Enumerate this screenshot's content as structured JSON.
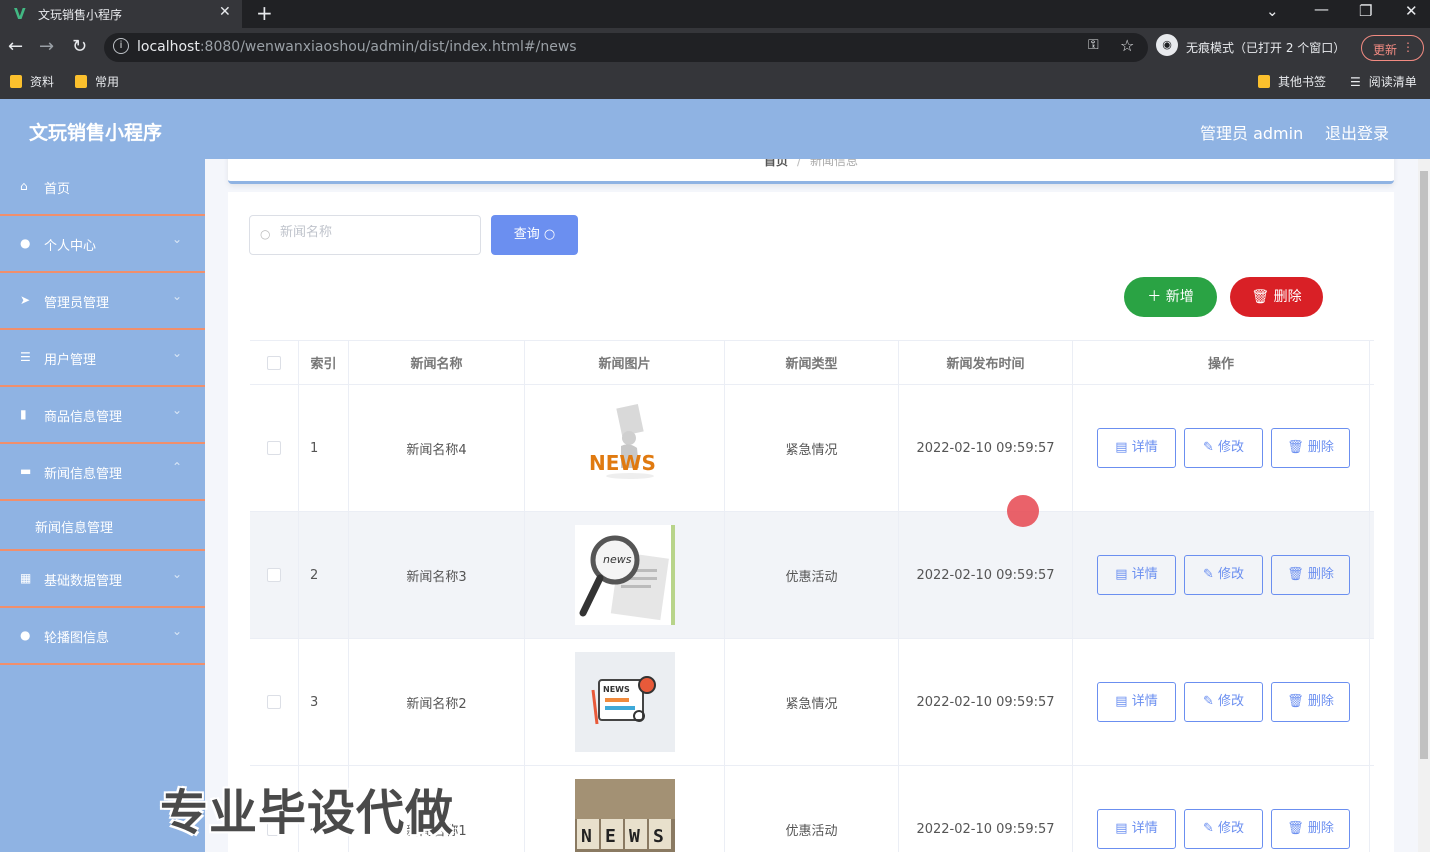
{
  "browser": {
    "tab_title": "文玩销售小程序",
    "url_host": "localhost",
    "url_path": ":8080/wenwanxiaoshou/admin/dist/index.html#/news",
    "incognito_label": "无痕模式（已打开 2 个窗口）",
    "update_label": "更新",
    "bookmarks": [
      "资料",
      "常用"
    ],
    "bookmarks_right": [
      "其他书签",
      "阅读清单"
    ]
  },
  "header": {
    "title": "文玩销售小程序",
    "admin_label": "管理员 admin",
    "logout_label": "退出登录"
  },
  "sidebar": {
    "items": [
      {
        "label": "首页",
        "icon": "home-icon"
      },
      {
        "label": "个人中心",
        "icon": "user-icon"
      },
      {
        "label": "管理员管理",
        "icon": "send-icon"
      },
      {
        "label": "用户管理",
        "icon": "list-icon"
      },
      {
        "label": "商品信息管理",
        "icon": "bar-chart-icon"
      },
      {
        "label": "新闻信息管理",
        "icon": "news-icon"
      },
      {
        "label": "基础数据管理",
        "icon": "grid-icon"
      },
      {
        "label": "轮播图信息",
        "icon": "user-icon"
      }
    ],
    "sub_item": "新闻信息管理"
  },
  "breadcrumb": {
    "home": "首页",
    "current": "新闻信息"
  },
  "search": {
    "placeholder": "新闻名称",
    "button": "查询"
  },
  "actions": {
    "add": "新增",
    "delete": "删除"
  },
  "table": {
    "columns": [
      "索引",
      "新闻名称",
      "新闻图片",
      "新闻类型",
      "新闻发布时间",
      "操作"
    ],
    "row_buttons": {
      "detail": "详情",
      "edit": "修改",
      "delete": "删除"
    },
    "rows": [
      {
        "index": "1",
        "name": "新闻名称4",
        "type": "紧急情况",
        "time": "2022-02-10 09:59:57",
        "image": "news-3d-figure"
      },
      {
        "index": "2",
        "name": "新闻名称3",
        "type": "优惠活动",
        "time": "2022-02-10 09:59:57",
        "image": "news-magnifier"
      },
      {
        "index": "3",
        "name": "新闻名称2",
        "type": "紧急情况",
        "time": "2022-02-10 09:59:57",
        "image": "news-flat-icon"
      },
      {
        "index": "4",
        "name": "新闻名称1",
        "type": "优惠活动",
        "time": "2022-02-10 09:59:57",
        "image": "news-blocks"
      }
    ]
  },
  "watermark": "专业毕设代做",
  "colors": {
    "header": "#8fb3e3",
    "accent": "#6b8ff0",
    "add": "#2aa344",
    "delete": "#d92026",
    "divider": "#f08f6c"
  }
}
